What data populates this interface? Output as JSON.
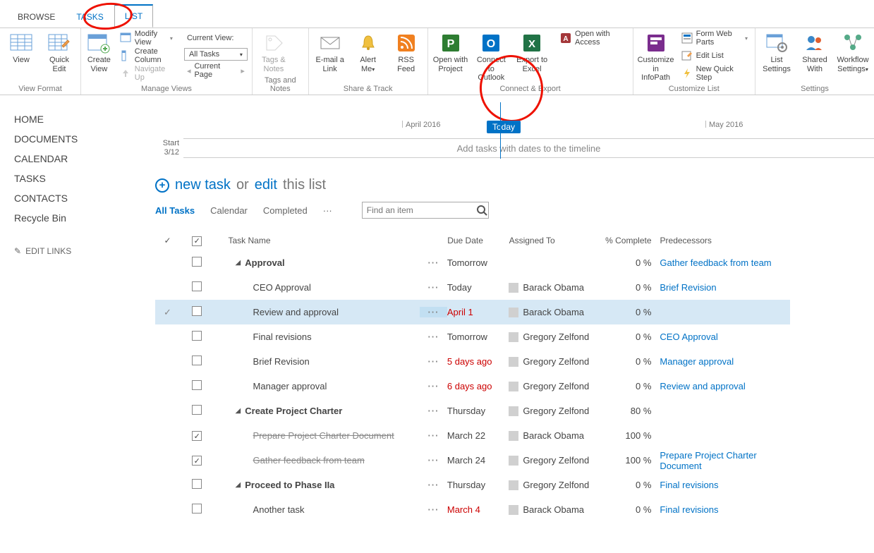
{
  "tabs": {
    "browse": "BROWSE",
    "tasks": "TASKS",
    "list": "LIST"
  },
  "ribbon": {
    "view": "View",
    "quick_edit": "Quick\nEdit",
    "view_format_label": "View Format",
    "create_view": "Create\nView",
    "modify_view": "Modify View",
    "create_column": "Create Column",
    "navigate_up": "Navigate Up",
    "current_view_label": "Current View:",
    "all_tasks_option": "All Tasks",
    "current_page": "Current Page",
    "manage_views_label": "Manage Views",
    "tags_notes": "Tags &\nNotes",
    "tags_notes_label": "Tags and Notes",
    "email_link": "E-mail a\nLink",
    "alert_me": "Alert\nMe",
    "rss_feed": "RSS\nFeed",
    "share_track_label": "Share & Track",
    "open_project": "Open with\nProject",
    "connect_outlook": "Connect to\nOutlook",
    "export_excel": "Export to\nExcel",
    "open_access": "Open with Access",
    "connect_export_label": "Connect & Export",
    "customize_infopath": "Customize in\nInfoPath",
    "form_web_parts": "Form Web Parts",
    "edit_list": "Edit List",
    "new_quick_step": "New Quick Step",
    "customize_list_label": "Customize List",
    "list_settings": "List\nSettings",
    "shared_with": "Shared\nWith",
    "workflow_settings": "Workflow\nSettings",
    "settings_label": "Settings"
  },
  "sidebar": {
    "items": [
      "HOME",
      "DOCUMENTS",
      "CALENDAR",
      "TASKS",
      "CONTACTS",
      "Recycle Bin"
    ],
    "edit_links": "EDIT LINKS"
  },
  "timeline": {
    "today_label": "Today",
    "months": {
      "apr": "April 2016",
      "may": "May 2016"
    },
    "start_label": "Start",
    "start_date": "3/12",
    "placeholder": "Add tasks with dates to the timeline"
  },
  "newtask": {
    "new_task": "new task",
    "or": "or",
    "edit": "edit",
    "this_list": "this list"
  },
  "views": {
    "all_tasks": "All Tasks",
    "calendar": "Calendar",
    "completed": "Completed",
    "more": "···",
    "search_placeholder": "Find an item"
  },
  "columns": {
    "task_name": "Task Name",
    "due_date": "Due Date",
    "assigned_to": "Assigned To",
    "pct_complete": "% Complete",
    "predecessors": "Predecessors"
  },
  "rows": [
    {
      "name": "Approval",
      "bold": true,
      "caret": true,
      "indent": 1,
      "due": "Tomorrow",
      "assigned": "",
      "pct": "0 %",
      "pred": "Gather feedback from team",
      "pred_link": true
    },
    {
      "name": "CEO Approval",
      "indent": 2,
      "due": "Today",
      "assigned": "Barack Obama",
      "pct": "0 %",
      "pred": "Brief Revision",
      "pred_link": true
    },
    {
      "name": "Review and approval",
      "indent": 2,
      "selected": true,
      "checkmark": true,
      "due": "April 1",
      "due_red": true,
      "assigned": "Barack Obama",
      "pct": "0 %",
      "pred": ""
    },
    {
      "name": "Final revisions",
      "indent": 2,
      "due": "Tomorrow",
      "assigned": "Gregory Zelfond",
      "pct": "0 %",
      "pred": "CEO Approval",
      "pred_link": true
    },
    {
      "name": "Brief Revision",
      "indent": 2,
      "due": "5 days ago",
      "due_red": true,
      "assigned": "Gregory Zelfond",
      "pct": "0 %",
      "pred": "Manager approval",
      "pred_link": true
    },
    {
      "name": "Manager approval",
      "indent": 2,
      "due": "6 days ago",
      "due_red": true,
      "assigned": "Gregory Zelfond",
      "pct": "0 %",
      "pred": "Review and approval",
      "pred_link": true
    },
    {
      "name": "Create Project Charter",
      "bold": true,
      "caret": true,
      "indent": 1,
      "due": "Thursday",
      "assigned": "Gregory Zelfond",
      "pct": "80 %",
      "pred": ""
    },
    {
      "name": "Prepare Project Charter Document",
      "indent": 2,
      "checked": true,
      "strike": true,
      "due": "March 22",
      "assigned": "Barack Obama",
      "pct": "100 %",
      "pred": ""
    },
    {
      "name": "Gather feedback from team",
      "indent": 2,
      "checked": true,
      "strike": true,
      "due": "March 24",
      "assigned": "Gregory Zelfond",
      "pct": "100 %",
      "pred": "Prepare Project Charter Document",
      "pred_link": true
    },
    {
      "name": "Proceed to Phase IIa",
      "bold": true,
      "caret": true,
      "indent": 1,
      "due": "Thursday",
      "assigned": "Gregory Zelfond",
      "pct": "0 %",
      "pred": "Final revisions",
      "pred_link": true
    },
    {
      "name": "Another task",
      "indent": 2,
      "due": "March 4",
      "due_red": true,
      "assigned": "Barack Obama",
      "pct": "0 %",
      "pred": "Final revisions",
      "pred_link": true
    }
  ]
}
